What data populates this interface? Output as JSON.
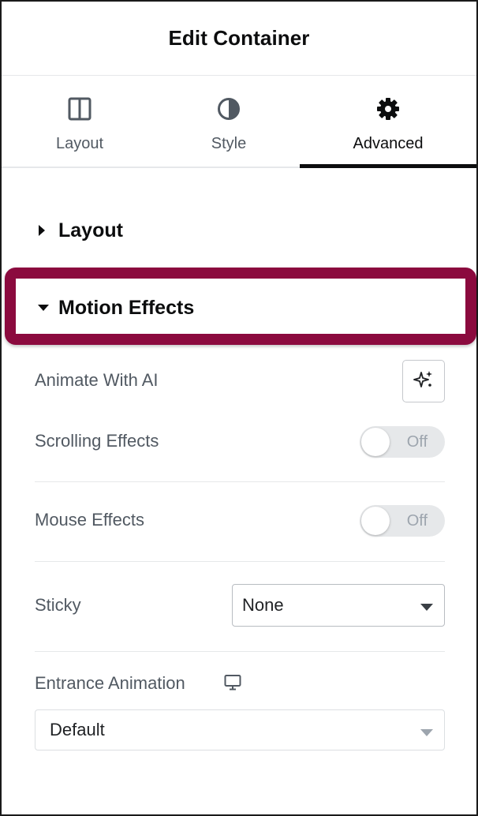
{
  "header": {
    "title": "Edit Container"
  },
  "tabs": [
    {
      "label": "Layout",
      "icon": "columns-icon"
    },
    {
      "label": "Style",
      "icon": "half-circle-icon"
    },
    {
      "label": "Advanced",
      "icon": "gear-icon",
      "active": true
    }
  ],
  "sections": {
    "layout": {
      "label": "Layout",
      "expanded": false
    },
    "motion": {
      "label": "Motion Effects",
      "expanded": true
    }
  },
  "motion_effects": {
    "animate_ai_label": "Animate With AI",
    "scrolling_label": "Scrolling Effects",
    "scrolling_state": "Off",
    "mouse_label": "Mouse Effects",
    "mouse_state": "Off",
    "sticky_label": "Sticky",
    "sticky_value": "None",
    "entrance_label": "Entrance Animation",
    "entrance_value": "Default"
  },
  "colors": {
    "highlight": "#8b0a3e",
    "active_tab_indicator": "#0c0d0e",
    "toggle_off_bg": "#e6e8ea"
  }
}
